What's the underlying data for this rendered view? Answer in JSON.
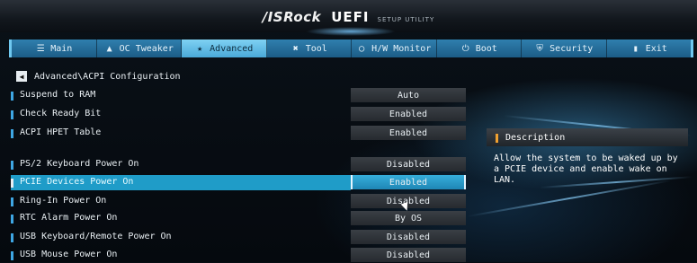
{
  "header": {
    "brand": "/ISRock",
    "product": "UEFI",
    "subtitle": "SETUP UTILITY"
  },
  "tabs": [
    {
      "label": "Main",
      "icon": "list-icon",
      "active": false
    },
    {
      "label": "OC Tweaker",
      "icon": "rocket-icon",
      "active": false
    },
    {
      "label": "Advanced",
      "icon": "star-icon",
      "active": true
    },
    {
      "label": "Tool",
      "icon": "tools-icon",
      "active": false
    },
    {
      "label": "H/W Monitor",
      "icon": "monitor-icon",
      "active": false
    },
    {
      "label": "Boot",
      "icon": "power-icon",
      "active": false
    },
    {
      "label": "Security",
      "icon": "shield-icon",
      "active": false
    },
    {
      "label": "Exit",
      "icon": "exit-icon",
      "active": false
    }
  ],
  "breadcrumb": "Advanced\\ACPI Configuration",
  "settings": [
    {
      "label": "Suspend to RAM",
      "value": "Auto"
    },
    {
      "label": "Check Ready Bit",
      "value": "Enabled"
    },
    {
      "label": "ACPI HPET Table",
      "value": "Enabled"
    },
    {
      "label": "PS/2 Keyboard Power On",
      "value": "Disabled"
    },
    {
      "label": "PCIE Devices Power On",
      "value": "Enabled",
      "selected": true
    },
    {
      "label": "Ring-In Power On",
      "value": "Disabled"
    },
    {
      "label": "RTC Alarm Power On",
      "value": "By OS"
    },
    {
      "label": "USB Keyboard/Remote Power On",
      "value": "Disabled"
    },
    {
      "label": "USB Mouse Power On",
      "value": "Disabled"
    }
  ],
  "description": {
    "title": "Description",
    "text": "Allow the system to be waked up by a PCIE device and enable wake on LAN."
  },
  "colors": {
    "accent": "#1f9cc8",
    "tab_bar": "#2f7fae",
    "active_tab": "#7fd1f3",
    "description_marker": "#f0a030"
  }
}
